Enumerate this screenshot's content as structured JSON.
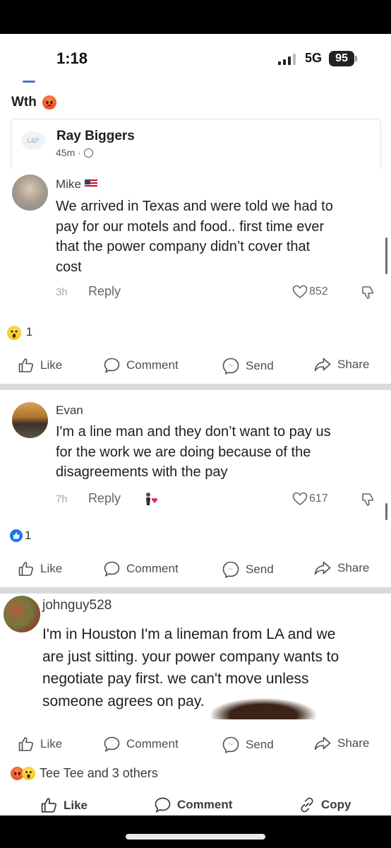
{
  "status_bar": {
    "time": "1:18",
    "network": "5G",
    "battery": "95"
  },
  "post": {
    "text": "Wth",
    "reaction_icon": "angry-emoji-icon"
  },
  "shared_post": {
    "author": "Ray Biggers",
    "time": "45m ·",
    "logo_text": "L&P"
  },
  "comments": [
    {
      "name": "Mike",
      "name_flag": "us-flag-icon",
      "lines": [
        "We arrived in Texas and were told we had to",
        "pay for our motels and food.. first time ever",
        "that the power company didn’t cover that",
        "cost"
      ],
      "time": "3h",
      "reply": "Reply",
      "likes": "852",
      "reaction_count": "1",
      "reaction_icon": "wow-emoji-icon"
    },
    {
      "name": "Evan",
      "lines": [
        "I'm a line man and they don’t want to pay us",
        "for the work we are doing because of the",
        "disagreements with the pay"
      ],
      "time": "7h",
      "reply": "Reply",
      "likes": "617",
      "reaction_count": "1",
      "reaction_icon": "like-reaction-icon"
    },
    {
      "name": "johnguy528",
      "lines": [
        "I'm in Houston I'm a lineman from LA and we",
        "are just sitting. your power company wants to",
        "negotiate pay first. we can't move unless",
        "someone agrees on pay."
      ]
    }
  ],
  "actions": {
    "like": "Like",
    "comment": "Comment",
    "send": "Send",
    "share": "Share",
    "copy": "Copy"
  },
  "bottom_reactions": {
    "text": "Tee Tee and 3 others"
  },
  "colors": {
    "accent": "#1877f2",
    "angry": "#e83c1e",
    "wow": "#f5b800",
    "separator": "#d9dbe0"
  }
}
